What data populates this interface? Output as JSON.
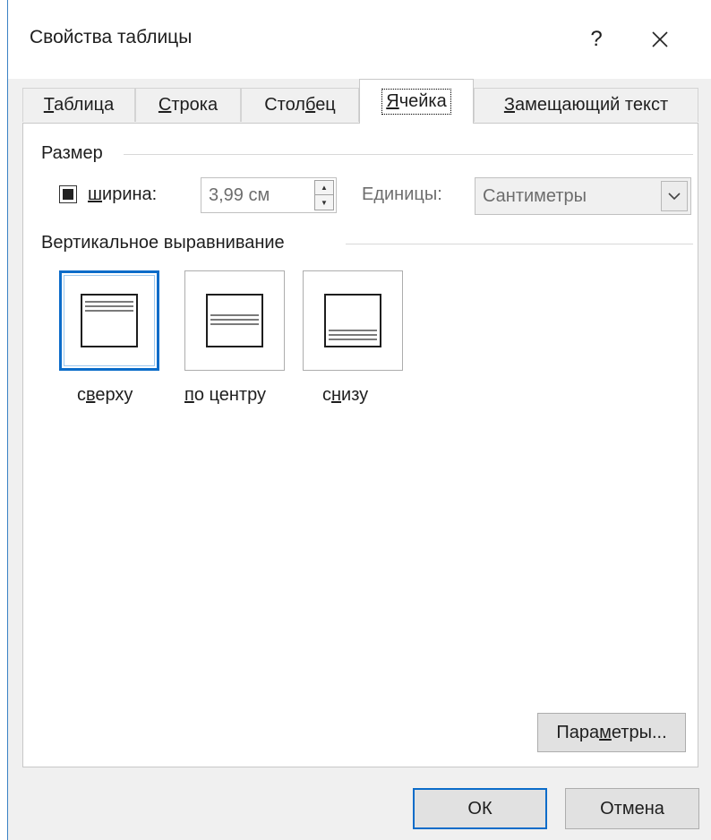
{
  "dialog": {
    "title": "Свойства таблицы",
    "help_label": "?",
    "close_icon": "close-icon"
  },
  "tabs": [
    {
      "u": "Т",
      "rest": "аблица"
    },
    {
      "u": "С",
      "rest": "трока"
    },
    {
      "pre": "Стол",
      "u": "б",
      "rest": "ец"
    },
    {
      "u": "Я",
      "rest": "чейка"
    },
    {
      "u": "З",
      "rest": "амещающий текст"
    }
  ],
  "active_tab": "Ячейка",
  "size": {
    "group_title": "Размер",
    "width_checked": true,
    "width_label_u": "ш",
    "width_label_rest": "ирина:",
    "width_value": "3,99 см",
    "units_label": "Единицы:",
    "units_value": "Сантиметры"
  },
  "valign": {
    "group_title": "Вертикальное выравнивание",
    "options": [
      {
        "pre": "с",
        "u": "в",
        "rest": "ерху",
        "selected": true
      },
      {
        "pre": "",
        "u": "п",
        "rest": "о центру",
        "selected": false
      },
      {
        "pre": "с",
        "u": "н",
        "rest": "изу",
        "selected": false
      }
    ]
  },
  "buttons": {
    "params_pre": "Пара",
    "params_u": "м",
    "params_rest": "етры...",
    "ok": "ОК",
    "cancel": "Отмена"
  },
  "colors": {
    "accent": "#0b6cc9",
    "dialog_bg": "#f0f0f0",
    "disabled_text": "#6d6d6d"
  }
}
